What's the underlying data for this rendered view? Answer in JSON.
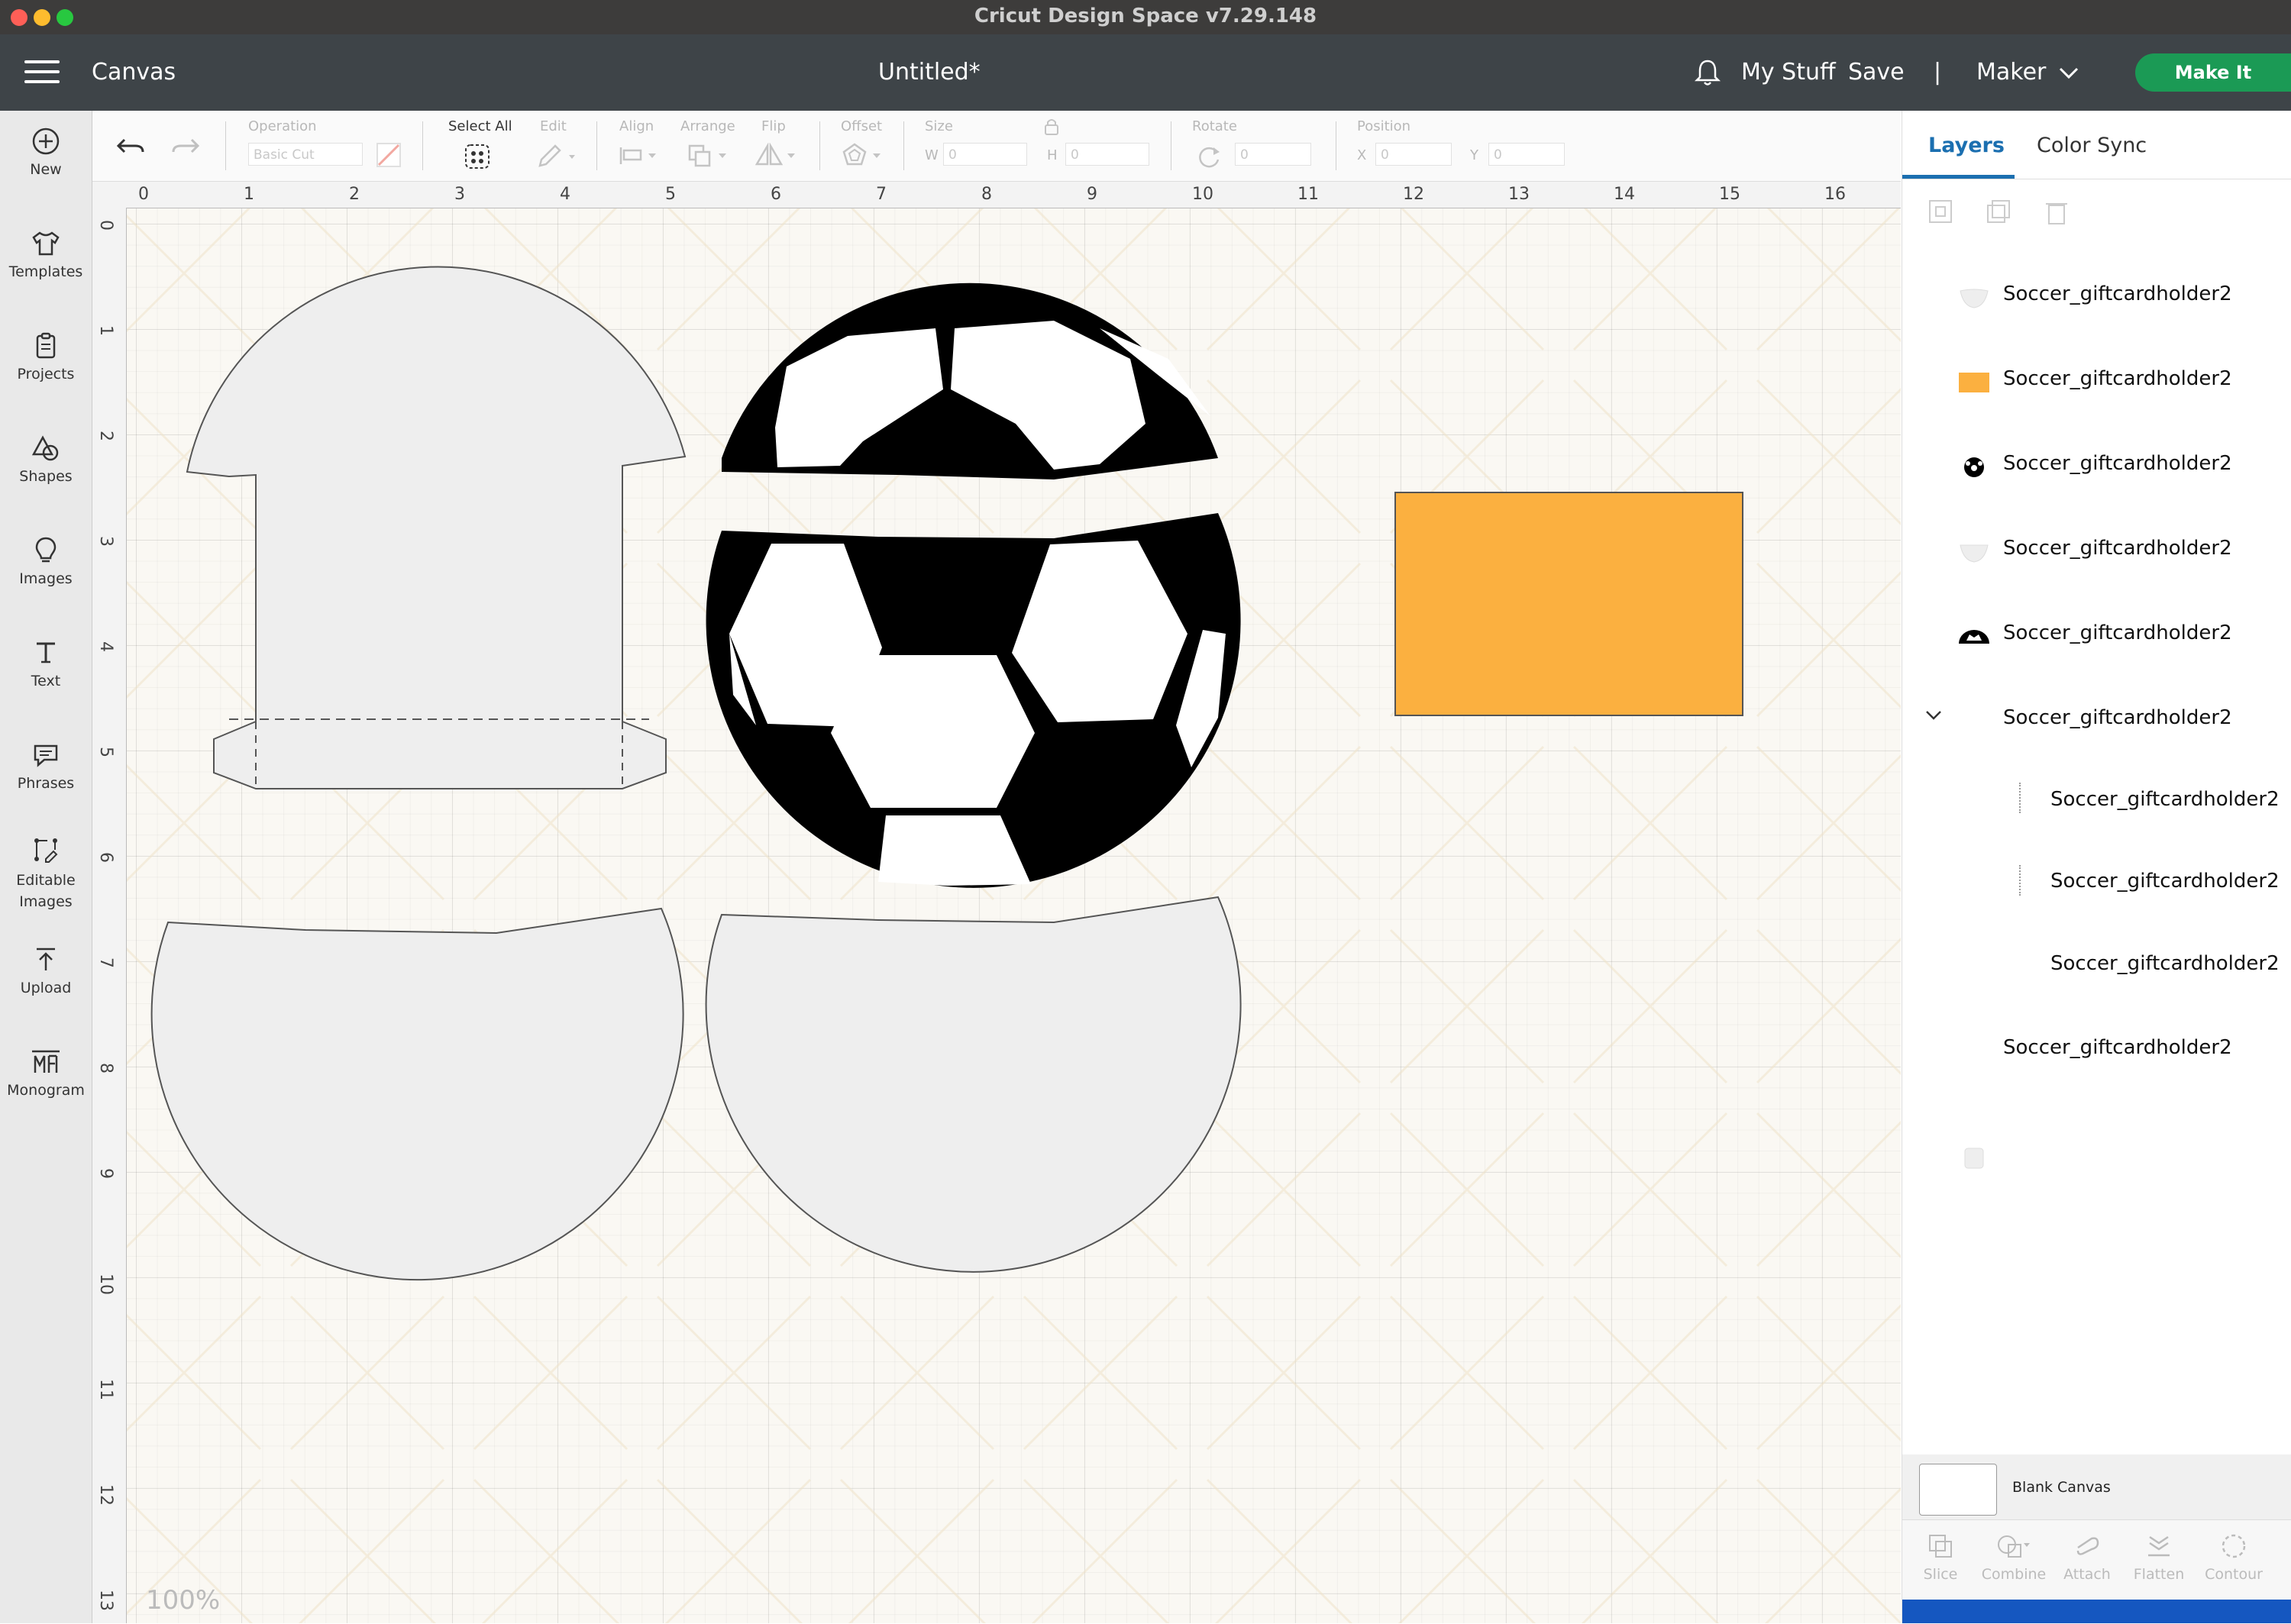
{
  "window": {
    "title": "Cricut Design Space  v7.29.148"
  },
  "header": {
    "left_label": "Canvas",
    "doc_title": "Untitled*",
    "my_stuff": "My Stuff",
    "save": "Save",
    "divider": "|",
    "machine": "Maker",
    "make_it": "Make It"
  },
  "left_tools": [
    {
      "label": "New",
      "icon": "plus-circle-icon"
    },
    {
      "label": "Templates",
      "icon": "tshirt-icon"
    },
    {
      "label": "Projects",
      "icon": "clipboard-icon"
    },
    {
      "label": "Shapes",
      "icon": "shapes-icon"
    },
    {
      "label": "Images",
      "icon": "lightbulb-icon"
    },
    {
      "label": "Text",
      "icon": "text-icon"
    },
    {
      "label": "Phrases",
      "icon": "speech-bubble-icon"
    },
    {
      "label": "Editable Images",
      "icon": "editable-image-icon"
    },
    {
      "label": "Upload",
      "icon": "upload-icon"
    },
    {
      "label": "Monogram",
      "icon": "monogram-icon"
    }
  ],
  "toolbar": {
    "operation_label": "Operation",
    "operation_value": "Basic Cut",
    "select_all": "Select All",
    "edit": "Edit",
    "align": "Align",
    "arrange": "Arrange",
    "flip": "Flip",
    "offset": "Offset",
    "size": "Size",
    "w": "W",
    "w_value": "0",
    "h": "H",
    "h_value": "0",
    "rotate": "Rotate",
    "rotate_value": "0",
    "position": "Position",
    "x": "X",
    "x_value": "0",
    "y": "Y",
    "y_value": "0"
  },
  "ruler": {
    "top": [
      "0",
      "1",
      "2",
      "3",
      "4",
      "5",
      "6",
      "7",
      "8",
      "9",
      "10",
      "11",
      "12",
      "13",
      "14",
      "15",
      "16"
    ],
    "left": [
      "0",
      "1",
      "2",
      "3",
      "4",
      "5",
      "6",
      "7",
      "8",
      "9",
      "10",
      "11",
      "12",
      "13"
    ]
  },
  "zoom": "100%",
  "colors": {
    "orange": "#fbb040",
    "accent": "#1b6fb0",
    "make_it": "#1b9a55"
  },
  "panel": {
    "tab_layers": "Layers",
    "tab_color_sync": "Color Sync",
    "layers": [
      {
        "name": "Soccer_giftcardholder2",
        "thumb": "light-shape"
      },
      {
        "name": "Soccer_giftcardholder2",
        "thumb": "orange-rect"
      },
      {
        "name": "Soccer_giftcardholder2",
        "thumb": "soccer-ball"
      },
      {
        "name": "Soccer_giftcardholder2",
        "thumb": "light-shape"
      },
      {
        "name": "Soccer_giftcardholder2",
        "thumb": "ball-top"
      },
      {
        "name": "Soccer_giftcardholder2",
        "thumb": "group"
      },
      {
        "name": "Soccer_giftcardholder2",
        "thumb": "child"
      },
      {
        "name": "Soccer_giftcardholder2",
        "thumb": "child"
      },
      {
        "name": "Soccer_giftcardholder2",
        "thumb": "child"
      },
      {
        "name": "Soccer_giftcardholder2",
        "thumb": "light-shape"
      }
    ],
    "blank_canvas": "Blank Canvas",
    "ops": [
      "Slice",
      "Combine",
      "Attach",
      "Flatten",
      "Contour"
    ]
  }
}
